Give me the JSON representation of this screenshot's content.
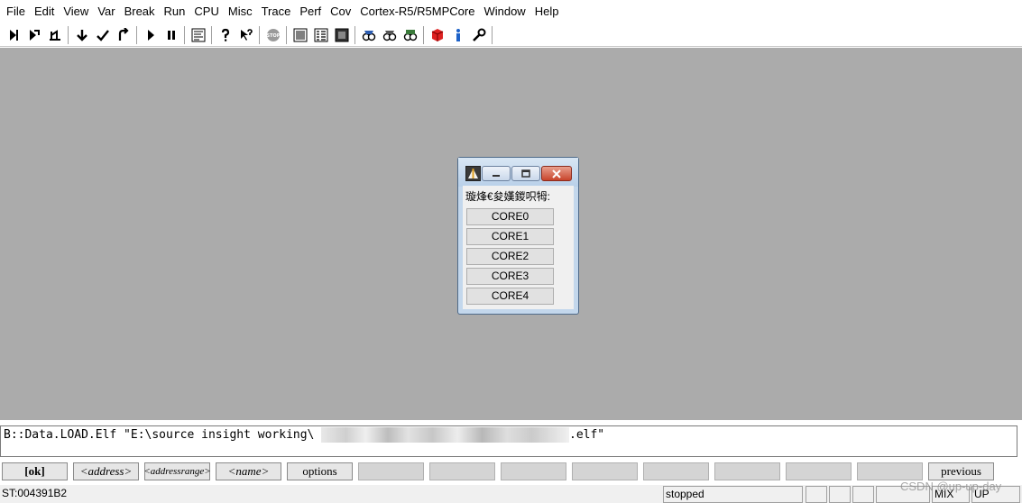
{
  "menu": [
    "File",
    "Edit",
    "View",
    "Var",
    "Break",
    "Run",
    "CPU",
    "Misc",
    "Trace",
    "Perf",
    "Cov",
    "Cortex-R5/R5MPCore",
    "Window",
    "Help"
  ],
  "toolbar": {
    "icons": [
      "step-into-icon",
      "step-over-icon",
      "step-return-icon",
      "down-arrow-icon",
      "check-step-icon",
      "return-icon",
      "go-icon",
      "break-icon",
      "source-list-icon",
      "help-icon",
      "context-help-icon",
      "stop-icon",
      "list-icon",
      "dump-icon",
      "register-icon",
      "view-icon-1",
      "view-icon-2",
      "view-icon-3",
      "cube-icon",
      "info-icon",
      "wrench-icon"
    ]
  },
  "dialog": {
    "label": "璇烽€夋嫨鍐呮牳:",
    "cores": [
      "CORE0",
      "CORE1",
      "CORE2",
      "CORE3",
      "CORE4"
    ]
  },
  "command": {
    "text": "B::Data.LOAD.Elf \"E:\\source insight working\\",
    "tail": ".elf\""
  },
  "softkeys": [
    "[ok]",
    "<address>",
    "<addressrange>",
    "<name>",
    "options",
    "",
    "",
    "",
    "",
    "",
    "",
    "",
    "",
    "previous"
  ],
  "status": {
    "address": "ST:004391B2",
    "state": "stopped",
    "mode": "MIX",
    "direction": "UP"
  },
  "watermark": "CSDN @up-up-day"
}
